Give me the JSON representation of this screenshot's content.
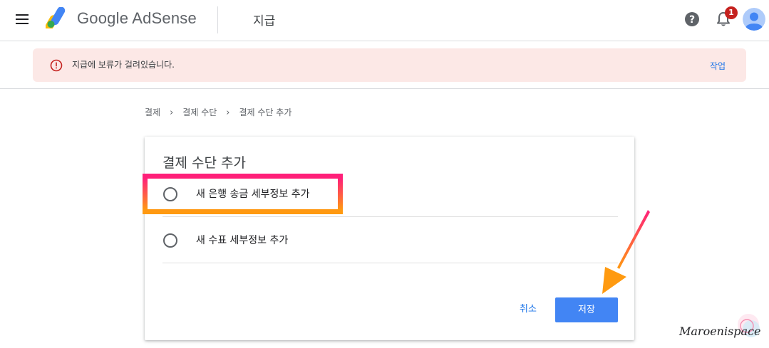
{
  "header": {
    "product_name": "Google AdSense",
    "page_title": "지급",
    "notification_count": "1",
    "menu_icon": "hamburger-menu-icon",
    "help_icon": "help-circle-icon",
    "bell_icon": "bell-icon",
    "avatar_icon": "user-avatar-icon"
  },
  "alert": {
    "message": "지급에 보류가 걸려있습니다.",
    "action_label": "작업",
    "icon": "error-circle-icon",
    "color": "#c5221f",
    "background": "#fce8e6"
  },
  "breadcrumb": {
    "items": [
      "결제",
      "결제 수단",
      "결제 수단 추가"
    ],
    "separator": "›"
  },
  "card": {
    "title": "결제 수단 추가",
    "options": [
      {
        "label": "새 은행 송금 세부정보 추가",
        "selected": false,
        "highlighted": true
      },
      {
        "label": "새 수표 세부정보 추가",
        "selected": false,
        "highlighted": false
      }
    ],
    "cancel_label": "취소",
    "save_label": "저장"
  },
  "colors": {
    "accent": "#1a73e8",
    "primary_button": "#4285f4",
    "highlight_gradient": [
      "#ff1f7a",
      "#ff9a10"
    ],
    "arrow_gradient": [
      "#ff1f7a",
      "#ff9a10"
    ]
  },
  "watermark": {
    "text": "Maroenispace"
  }
}
